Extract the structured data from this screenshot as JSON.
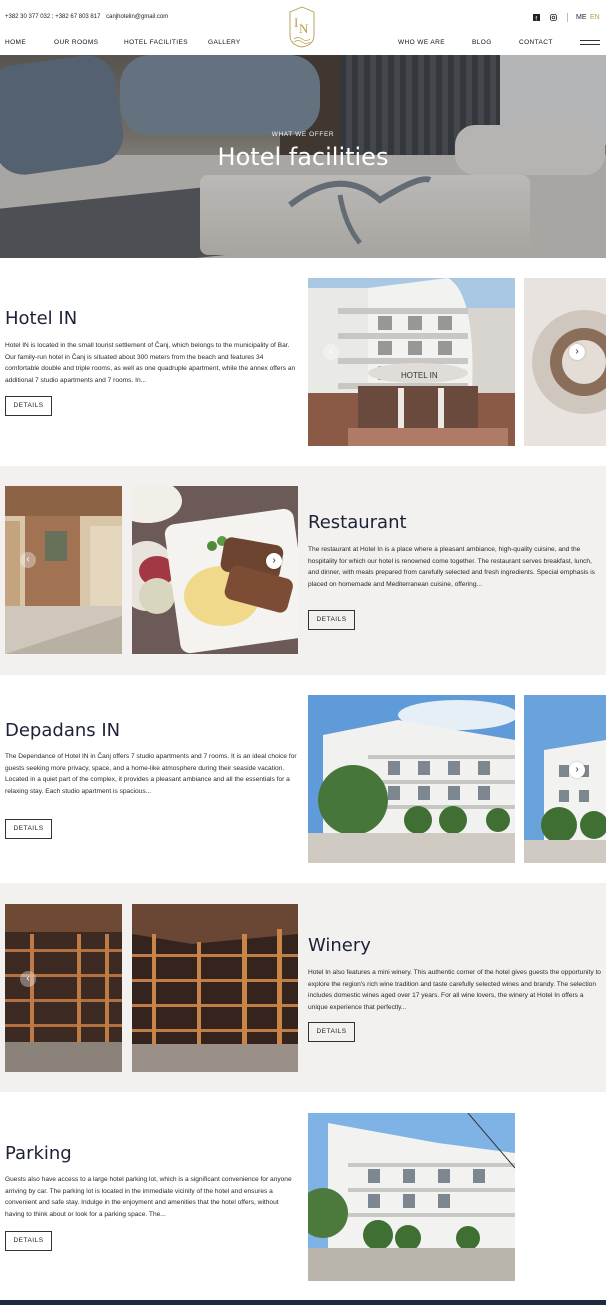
{
  "header": {
    "phones": "+382 30 377 032 ; +382 67 803 817",
    "email": "canjhotelin@gmail.com",
    "nav_left": [
      "HOME",
      "OUR ROOMS",
      "HOTEL FACILITIES",
      "GALLERY"
    ],
    "nav_right": [
      "WHO WE ARE",
      "BLOG",
      "CONTACT"
    ],
    "lang_me": "ME",
    "lang_en": "EN",
    "icons": [
      "facebook-icon",
      "instagram-icon",
      "menu-icon"
    ],
    "accent_color": "#b79a4d"
  },
  "hero": {
    "kicker": "WHAT WE OFFER",
    "title": "Hotel facilities"
  },
  "sections": [
    {
      "title": "Hotel IN",
      "text": "Hotel IN is located in the small tourist settlement of Čanj, which belongs to the municipality of Bar. Our family-run hotel in Čanj is situated about 300 meters from the beach and features 34 comfortable double and triple rooms, as well as one quadruple apartment, while the annex offers an additional 7 studio apartments and 7 rooms.   In...",
      "button": "DETAILS"
    },
    {
      "title": "Restaurant",
      "text": "The restaurant at Hotel In is a place where a pleasant ambiance, high-quality cuisine, and the hospitality for which our hotel is renowned come together. The restaurant serves breakfast, lunch, and dinner, with meals prepared from carefully selected and fresh ingredients. Special emphasis is placed on homemade and Mediterranean cuisine, offering...",
      "button": "DETAILS"
    },
    {
      "title": "Depadans IN",
      "text": "The Dependance of Hotel IN in Čanj offers 7 studio apartments and 7 rooms. It is an ideal choice for guests seeking more privacy, space, and a home-like atmosphere during their seaside vacation. Located in a quiet part of the complex, it provides a pleasant ambiance and all the essentials for a relaxing stay. Each studio apartment is spacious...",
      "button": "DETAILS"
    },
    {
      "title": "Winery",
      "text": "Hotel In also features a mini winery. This authentic corner of the hotel gives guests the opportunity to explore the region's rich wine tradition and taste carefully selected wines and brandy. The selection includes domestic wines aged over 17 years. For all wine lovers, the winery at Hotel In offers a unique experience that perfectly...",
      "button": "DETAILS"
    },
    {
      "title": "Parking",
      "text": "Guests also have access to a large hotel parking lot, which is a significant convenience for anyone arriving by car. The parking lot is located in the immediate vicinity of the hotel and ensures a convenient and safe stay. Indulge in the enjoyment and amenities that the hotel offers, without having to think about or look for a parking space. The...",
      "button": "DETAILS"
    }
  ],
  "photo_sign": "HOTEL IN"
}
